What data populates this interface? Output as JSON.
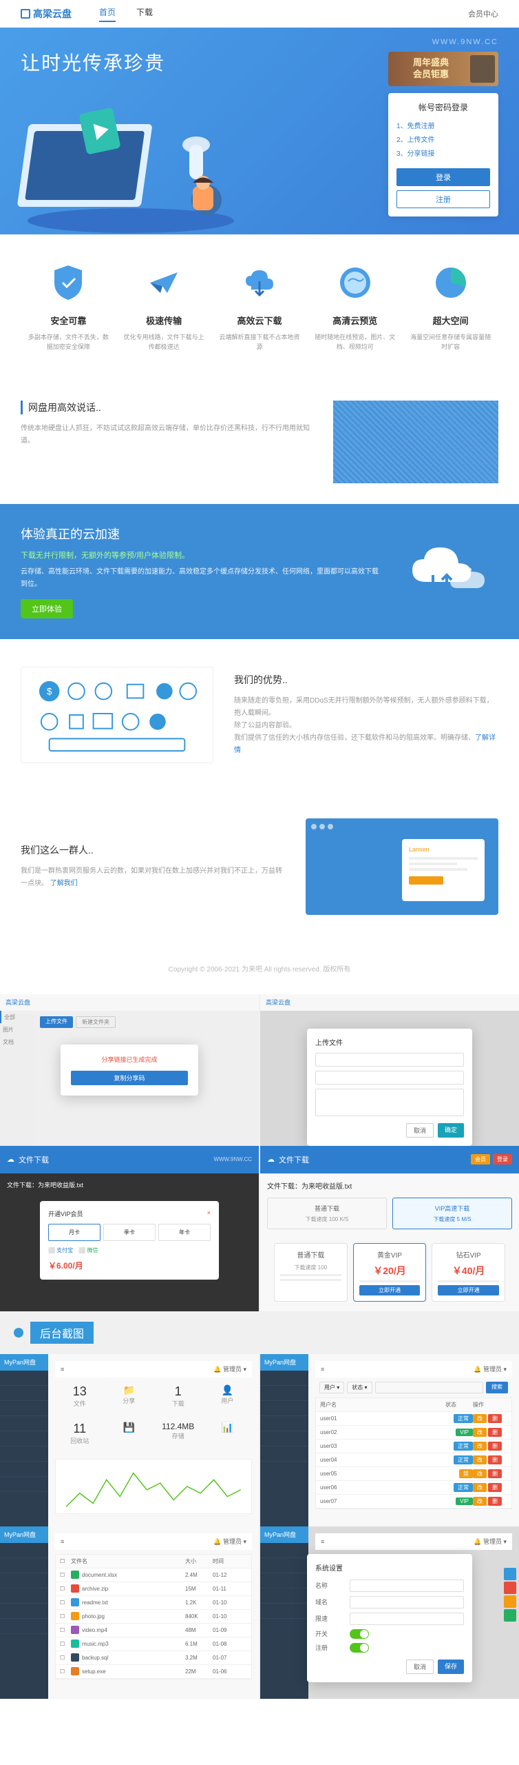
{
  "header": {
    "logo": "高梁云盘",
    "nav": [
      "首页",
      "下载"
    ],
    "member": "会员中心"
  },
  "hero": {
    "title": "让时光传承珍贵",
    "watermark": "WWW.9NW.CC",
    "promo_line1": "周年盛典",
    "promo_line2": "会员钜惠",
    "login_title": "帐号密码登录",
    "step1": "1、免费注册",
    "step2": "2、上传文件",
    "step3": "3、分享链接",
    "login_btn": "登录",
    "register_btn": "注册"
  },
  "features": [
    {
      "title": "安全可靠",
      "desc": "多副本存储，文件不丢失，数据加密安全保障"
    },
    {
      "title": "极速传输",
      "desc": "优化专用线路，文件下载与上传都极速达"
    },
    {
      "title": "高效云下载",
      "desc": "云端解析直接下载不占本地资源"
    },
    {
      "title": "高清云预览",
      "desc": "随时随地在线预览，图片、文档、视频均可"
    },
    {
      "title": "超大空间",
      "desc": "海量空间任意存储专属容量随时扩容"
    }
  ],
  "testimonial": {
    "title": "网盘用高效说话..",
    "text": "传统本地硬盘让人抓狂，不妨试试这款超高效云端存储，单价比存价还黑科技，行不行用用就知道。"
  },
  "accelerate": {
    "title": "体验真正的云加速",
    "sub": "下载无并行限制，无额外的等参预/用户体验限制。",
    "desc": "云存储、高性能云环境、文件下载需要的加速能力、高效稳定多个缓点存储分发技术、任何网络，里面都可以高效下载到位。",
    "btn": "立即体验"
  },
  "advantage": {
    "title": "我们的优势..",
    "text1": "随来随走的零负担，采用DDoS无并行限制额外防等候预制，无人额外感参顾料下载，抱人载瞬间。",
    "text2": "除了公益内容部验。",
    "text3": "我们提供了信任的大小核内存信任验，还下载软件和马的阻高效率。明确存储、",
    "link": "了解详情"
  },
  "team": {
    "title": "我们这么一群人..",
    "text": "我们是一群热衷网页服务人云的数，如果对我们在数上加感兴并对我们不正上，万益转一点块。",
    "link": "了解我们"
  },
  "footer": "Copyright © 2006-2021 为来吧 All rights reserved. 版权所有",
  "section_label": "后台截图",
  "admin_brand": "MyPan网盘",
  "file_download": {
    "header": "文件下载",
    "title": "文件下载：为来吧收益版.txt",
    "normal": "普通下载",
    "vip": "VIP高速下载",
    "speed1": "下载速度 100 K/S",
    "speed2": "下载速度 5 M/S",
    "price_label": "￥6.00/月"
  },
  "pricing": {
    "p1_title": "普通下载",
    "p1_speed": "下载速度 100",
    "p2_title": "黄金VIP",
    "p2_price": "￥20/月",
    "p3_title": "钻石VIP",
    "p3_price": "￥40/月"
  },
  "stats": {
    "s1": "13",
    "s1_label": "文件",
    "s2": "1",
    "s2_label": "分享",
    "s3": "11",
    "s3_label": "回收站",
    "s4": "112.4MB",
    "s4_label": "存储"
  },
  "modal1": {
    "text": "分享链接已生成完成",
    "btn": "复制分享码"
  }
}
